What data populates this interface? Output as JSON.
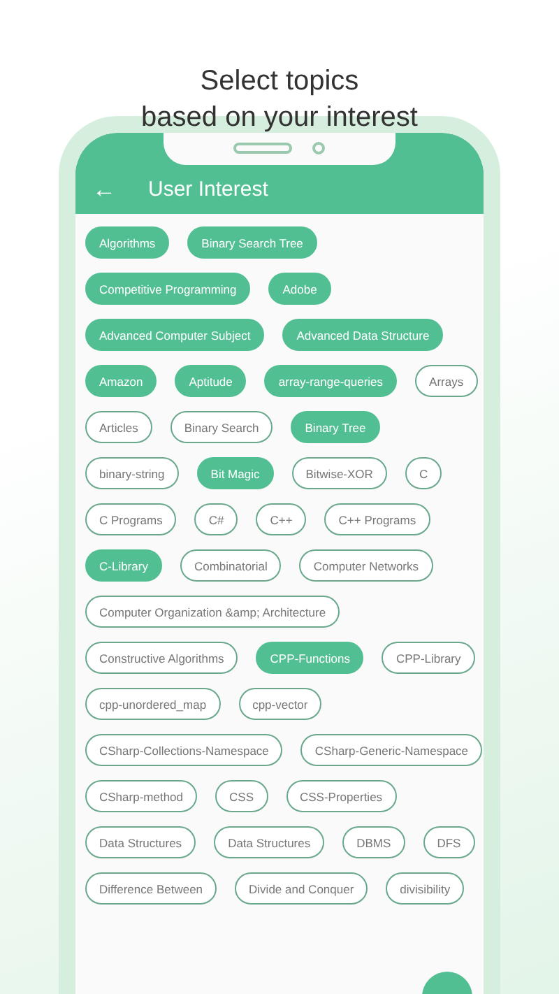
{
  "headline": [
    "Select topics",
    "based on your interest"
  ],
  "app_bar": {
    "title": "User Interest",
    "back_icon": "←"
  },
  "topic_rows": [
    [
      {
        "label": "Algorithms",
        "selected": true
      },
      {
        "label": "Binary Search Tree",
        "selected": true
      }
    ],
    [
      {
        "label": "Competitive Programming",
        "selected": true
      },
      {
        "label": "Adobe",
        "selected": true
      }
    ],
    [
      {
        "label": "Advanced Computer Subject",
        "selected": true
      },
      {
        "label": "Advanced Data Structure",
        "selected": true
      }
    ],
    [
      {
        "label": "Amazon",
        "selected": true
      },
      {
        "label": "Aptitude",
        "selected": true
      },
      {
        "label": "array-range-queries",
        "selected": true
      },
      {
        "label": "Arrays",
        "selected": false
      }
    ],
    [
      {
        "label": "Articles",
        "selected": false
      },
      {
        "label": "Binary Search",
        "selected": false
      },
      {
        "label": "Binary Tree",
        "selected": true
      }
    ],
    [
      {
        "label": "binary-string",
        "selected": false
      },
      {
        "label": "Bit Magic",
        "selected": true
      },
      {
        "label": "Bitwise-XOR",
        "selected": false
      },
      {
        "label": "C",
        "selected": false
      }
    ],
    [
      {
        "label": "C Programs",
        "selected": false
      },
      {
        "label": "C#",
        "selected": false
      },
      {
        "label": "C++",
        "selected": false
      },
      {
        "label": "C++ Programs",
        "selected": false
      }
    ],
    [
      {
        "label": "C-Library",
        "selected": true
      },
      {
        "label": "Combinatorial",
        "selected": false
      },
      {
        "label": "Computer Networks",
        "selected": false
      }
    ],
    [
      {
        "label": "Computer Organization &amp; Architecture",
        "selected": false
      }
    ],
    [
      {
        "label": "Constructive Algorithms",
        "selected": false
      },
      {
        "label": "CPP-Functions",
        "selected": true
      },
      {
        "label": "CPP-Library",
        "selected": false
      }
    ],
    [
      {
        "label": "cpp-unordered_map",
        "selected": false
      },
      {
        "label": "cpp-vector",
        "selected": false
      }
    ],
    [
      {
        "label": "CSharp-Collections-Namespace",
        "selected": false
      },
      {
        "label": "CSharp-Generic-Namespace",
        "selected": false
      }
    ],
    [
      {
        "label": "CSharp-method",
        "selected": false
      },
      {
        "label": "CSS",
        "selected": false
      },
      {
        "label": "CSS-Properties",
        "selected": false
      }
    ],
    [
      {
        "label": "Data Structures",
        "selected": false
      },
      {
        "label": "Data Structures",
        "selected": false
      },
      {
        "label": "DBMS",
        "selected": false
      },
      {
        "label": "DFS",
        "selected": false
      }
    ],
    [
      {
        "label": "Difference Between",
        "selected": false
      },
      {
        "label": "Divide and Conquer",
        "selected": false
      },
      {
        "label": "divisibility",
        "selected": false
      }
    ]
  ]
}
